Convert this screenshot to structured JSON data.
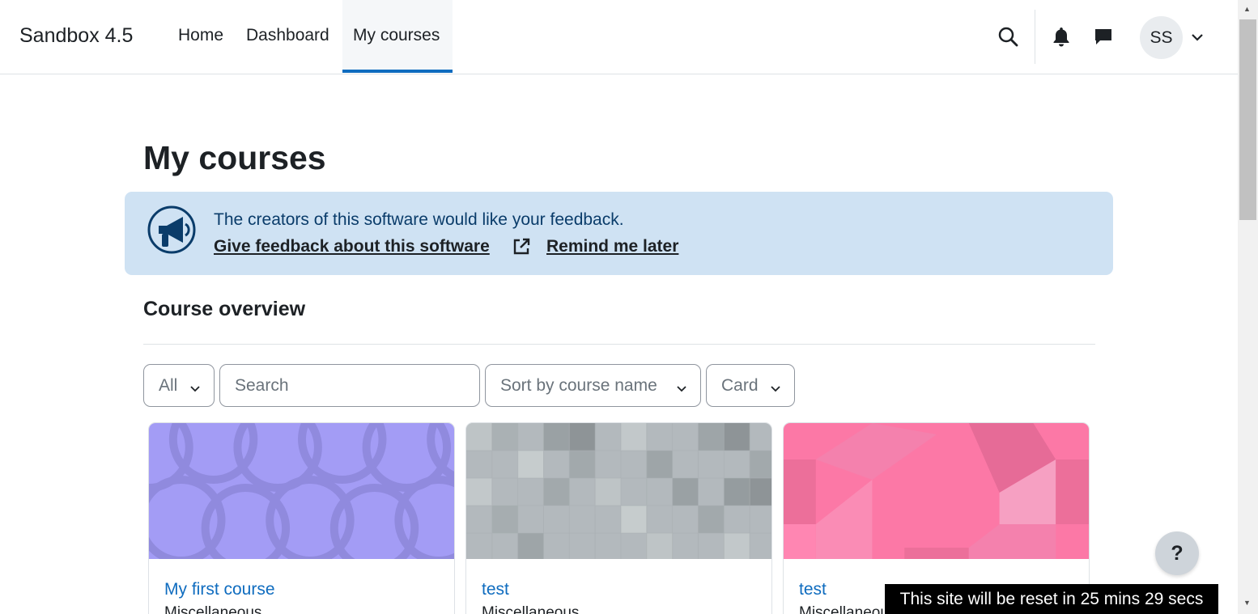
{
  "navbar": {
    "brand": "Sandbox 4.5",
    "links": [
      {
        "label": "Home"
      },
      {
        "label": "Dashboard"
      },
      {
        "label": "My courses",
        "active": true
      }
    ],
    "user_initials": "SS",
    "icons": [
      "search-icon",
      "bell-icon",
      "chat-icon",
      "chevron-down-icon"
    ]
  },
  "page": {
    "title": "My courses"
  },
  "feedback": {
    "message": "The creators of this software would like your feedback.",
    "give_feedback": "Give feedback about this software",
    "remind_later": "Remind me later",
    "icon": "megaphone-icon"
  },
  "course_overview": {
    "title": "Course overview",
    "filter_selected": "All",
    "search_placeholder": "Search",
    "sort_selected": "Sort by course name",
    "view_selected": "Card"
  },
  "courses": [
    {
      "name": "My first course",
      "category": "Miscellaneous",
      "pattern_color": "#a39cf5"
    },
    {
      "name": "test",
      "category": "Miscellaneous",
      "pattern_color": "#b3b9bd"
    },
    {
      "name": "test",
      "category": "Miscellaneous",
      "pattern_color": "#fc78a6"
    }
  ],
  "help_label": "?",
  "reset_banner": "This site will be reset in 25 mins 29 secs",
  "colors": {
    "accent": "#0f6cbf",
    "alert_bg": "#cfe2f3",
    "alert_text": "#0a3c6a"
  }
}
